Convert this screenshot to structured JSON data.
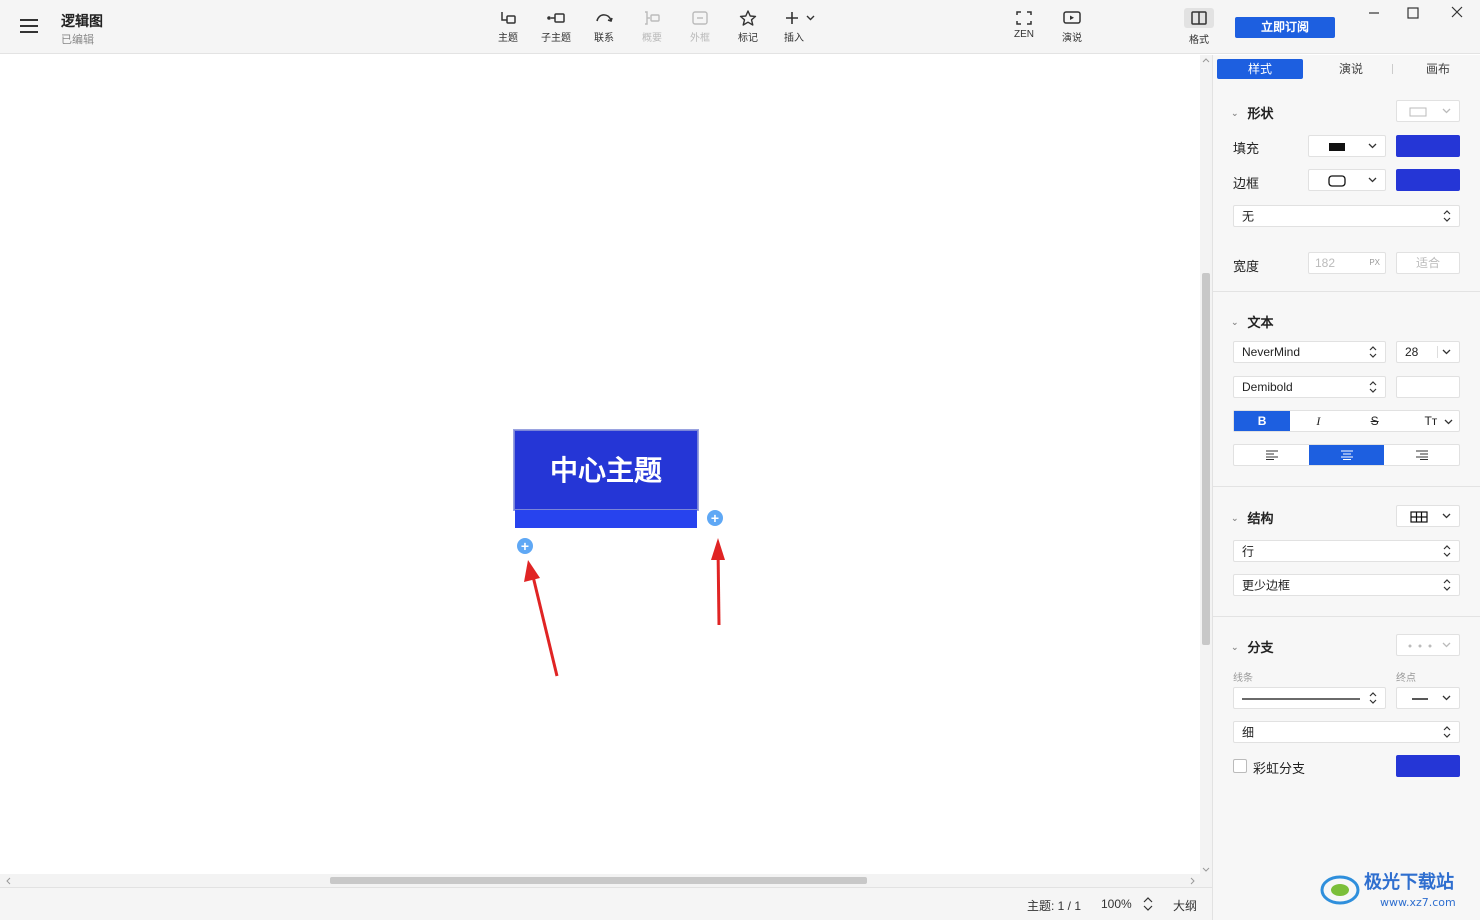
{
  "window": {
    "title": "逻辑图",
    "status": "已编辑",
    "subscribe_label": "立即订阅"
  },
  "toolbar": {
    "items": [
      {
        "label": "主题",
        "icon": "topic-icon",
        "disabled": false
      },
      {
        "label": "子主题",
        "icon": "subtopic-icon",
        "disabled": false
      },
      {
        "label": "联系",
        "icon": "relationship-icon",
        "disabled": false
      },
      {
        "label": "概要",
        "icon": "summary-icon",
        "disabled": true
      },
      {
        "label": "外框",
        "icon": "boundary-icon",
        "disabled": true
      },
      {
        "label": "标记",
        "icon": "star-icon",
        "disabled": false
      },
      {
        "label": "插入",
        "icon": "plus-icon",
        "disabled": false
      }
    ],
    "right_items": [
      {
        "label": "ZEN",
        "icon": "fullscreen-icon"
      },
      {
        "label": "演说",
        "icon": "present-icon"
      },
      {
        "label": "格式",
        "icon": "format-panel-icon"
      }
    ]
  },
  "canvas": {
    "central_topic": "中心主题"
  },
  "statusbar": {
    "topic_count": "主题: 1 / 1",
    "zoom": "100%",
    "outline": "大纲"
  },
  "panel": {
    "tabs": [
      "样式",
      "演说",
      "画布"
    ],
    "active_tab": 0,
    "shape": {
      "title": "形状",
      "fill_label": "填充",
      "border_label": "边框",
      "border_option": "无",
      "width_label": "宽度",
      "width_value": "182",
      "width_unit": "PX",
      "fit_label": "适合"
    },
    "text": {
      "title": "文本",
      "font": "NeverMind",
      "size": "28",
      "weight": "Demibold",
      "bold": "B",
      "italic": "I",
      "strike": "S",
      "case": "Tт"
    },
    "structure": {
      "title": "结构",
      "layout": "行",
      "border": "更少边框"
    },
    "branch": {
      "title": "分支",
      "line_label": "线条",
      "end_label": "终点",
      "thickness": "细",
      "rainbow_label": "彩虹分支"
    }
  },
  "colors": {
    "accent": "#1d5fe0",
    "topic_fill": "#2536d6",
    "arrow": "#e02424"
  }
}
